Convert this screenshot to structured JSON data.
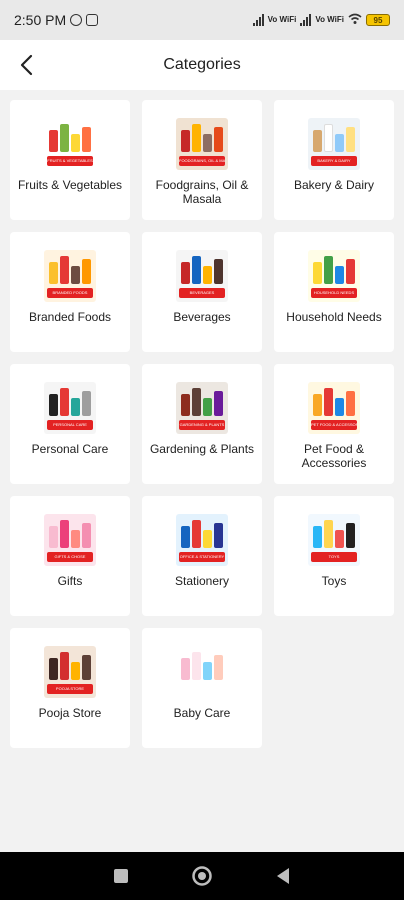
{
  "status_bar": {
    "time": "2:50 PM",
    "battery": "95",
    "network_label": "Vo WiFi"
  },
  "header": {
    "title": "Categories"
  },
  "categories": [
    {
      "label": "Fruits & Vegetables",
      "tag": "FRUITS & VEGETABLES",
      "bg": "#ffffff",
      "colors": [
        "#e53935",
        "#7cb342",
        "#fdd835",
        "#ff7043"
      ]
    },
    {
      "label": "Foodgrains, Oil & Masala",
      "tag": "FOODGRAINS, OIL & MASALA",
      "bg": "#f0e2d2",
      "colors": [
        "#c62828",
        "#ffb300",
        "#8d6e63",
        "#e64a19"
      ]
    },
    {
      "label": "Bakery & Dairy",
      "tag": "BAKERY & DAIRY",
      "bg": "#eef3f7",
      "colors": [
        "#d7a86e",
        "#ffffff",
        "#90caf9",
        "#ffe082"
      ]
    },
    {
      "label": "Branded Foods",
      "tag": "BRANDED FOODS",
      "bg": "#fff3e0",
      "colors": [
        "#fbc02d",
        "#e53935",
        "#6d4c41",
        "#ff9800"
      ]
    },
    {
      "label": "Beverages",
      "tag": "BEVERAGES",
      "bg": "#f5f5f5",
      "colors": [
        "#c62828",
        "#1565c0",
        "#ffb300",
        "#4e342e"
      ]
    },
    {
      "label": "Household Needs",
      "tag": "HOUSEHOLD NEEDS",
      "bg": "#fffde7",
      "colors": [
        "#fdd835",
        "#43a047",
        "#1e88e5",
        "#e53935"
      ]
    },
    {
      "label": "Personal Care",
      "tag": "PERSONAL CARE",
      "bg": "#f5f5f5",
      "colors": [
        "#212121",
        "#e53935",
        "#26a69a",
        "#9e9e9e"
      ]
    },
    {
      "label": "Gardening & Plants",
      "tag": "GARDENING & PLANTS",
      "bg": "#ece7e1",
      "colors": [
        "#8d2c1e",
        "#5d4037",
        "#43a047",
        "#6a1b9a"
      ]
    },
    {
      "label": "Pet Food & Accessories",
      "tag": "PET FOOD & ACCESSORIES",
      "bg": "#fff8e1",
      "colors": [
        "#f9a825",
        "#e53935",
        "#1e88e5",
        "#ff7043"
      ]
    },
    {
      "label": "Gifts",
      "tag": "GIFTS & CHOSE",
      "bg": "#fce4ec",
      "colors": [
        "#f8bbd0",
        "#ec407a",
        "#ff8a80",
        "#f48fb1"
      ]
    },
    {
      "label": "Stationery",
      "tag": "OFFICE & STATIONERY",
      "bg": "#e3f2fd",
      "colors": [
        "#1565c0",
        "#e53935",
        "#fdd835",
        "#283593"
      ]
    },
    {
      "label": "Toys",
      "tag": "TOYS",
      "bg": "#f1f8fe",
      "colors": [
        "#29b6f6",
        "#ffd54f",
        "#ef5350",
        "#212121"
      ]
    },
    {
      "label": "Pooja Store",
      "tag": "POOJA STORE",
      "bg": "#f3e5d8",
      "colors": [
        "#3e2723",
        "#d32f2f",
        "#ffb300",
        "#5d4037"
      ]
    },
    {
      "label": "Baby Care",
      "tag": "",
      "bg": "#ffffff",
      "colors": [
        "#f8bbd0",
        "#fce4ec",
        "#81d4fa",
        "#ffccbc"
      ]
    }
  ],
  "nav_bar": {
    "recent_icon": "square-icon",
    "home_icon": "circle-icon",
    "back_icon": "triangle-back-icon"
  }
}
